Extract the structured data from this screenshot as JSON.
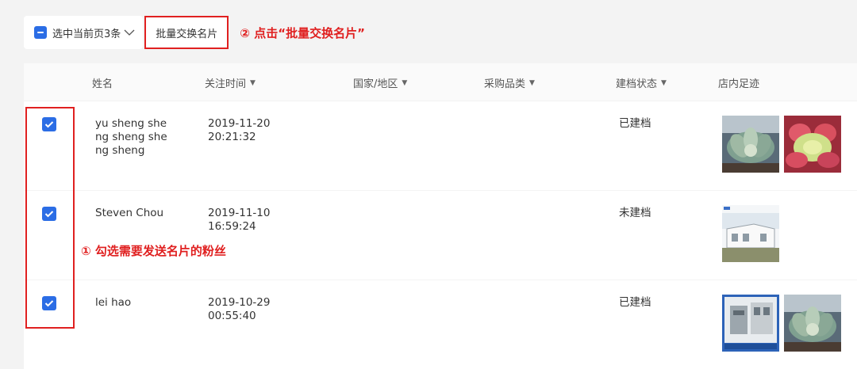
{
  "toolbar": {
    "select_label": "选中当前页3条",
    "batch_button_label": "批量交换名片"
  },
  "annotations": {
    "step1": "① 勾选需要发送名片的粉丝",
    "step2": "② 点击“批量交换名片”"
  },
  "table": {
    "headers": {
      "name": "姓名",
      "follow_time": "关注时间",
      "country": "国家/地区",
      "category": "采购品类",
      "status": "建档状态",
      "footprint": "店内足迹"
    },
    "rows": [
      {
        "name": "yu sheng sheng sheng sheng sheng",
        "date": "2019-11-20",
        "time": "20:21:32",
        "status": "已建档",
        "checked": true
      },
      {
        "name": "Steven Chou",
        "date": "2019-11-10",
        "time": "16:59:24",
        "status": "未建档",
        "checked": true
      },
      {
        "name": "lei hao",
        "date": "2019-10-29",
        "time": "00:55:40",
        "status": "已建档",
        "checked": true
      }
    ]
  },
  "colors": {
    "accent": "#2b6de5",
    "annotation_red": "#e02020"
  },
  "icons": {
    "header_select": "indeterminate-checkbox-icon",
    "dropdown": "chevron-down-icon",
    "sort": "caret-down-icon",
    "row_select": "checkbox-checked-icon"
  }
}
